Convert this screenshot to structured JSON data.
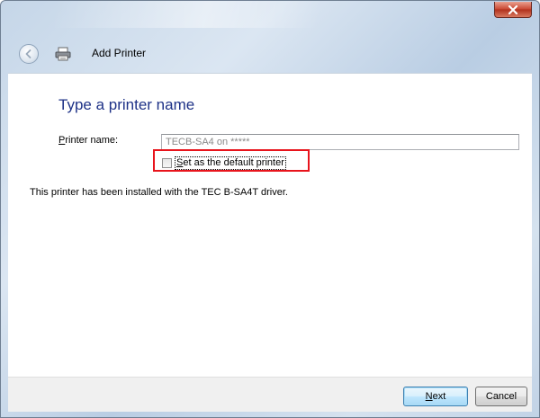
{
  "window": {
    "title": "Add Printer",
    "close_icon": "close-icon"
  },
  "header": {
    "back_icon": "back-arrow-icon",
    "printer_icon": "printer-icon",
    "title": "Add Printer"
  },
  "page": {
    "heading": "Type a printer name",
    "printer_name_label_first": "P",
    "printer_name_label_rest": "rinter name:",
    "printer_name_value": "TECB-SA4 on *****",
    "default_checkbox_label_first": "S",
    "default_checkbox_label_rest": "et as the default printer",
    "default_checkbox_checked": false,
    "info_text": "This printer has been installed with the TEC B-SA4T driver."
  },
  "footer": {
    "next_first": "N",
    "next_rest": "ext",
    "cancel_label": "Cancel"
  },
  "colors": {
    "heading": "#1e3287",
    "highlight_border": "#e8141c",
    "close_button": "#c9452f"
  }
}
